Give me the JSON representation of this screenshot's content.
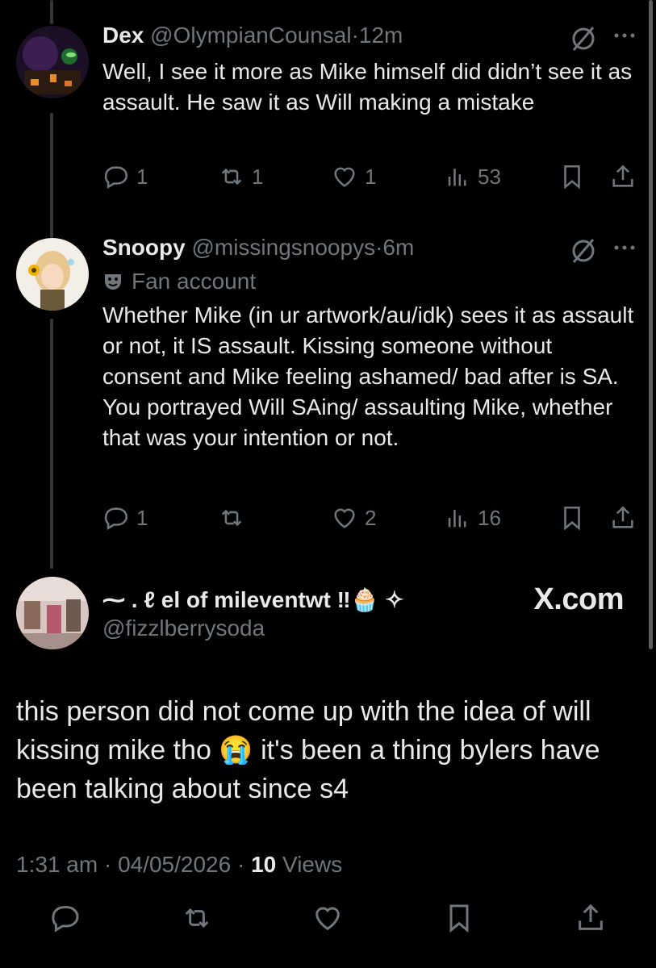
{
  "tweets": [
    {
      "name": "Dex",
      "handle": "@OlympianCounsal",
      "time": "12m",
      "text": "Well, I see it more as Mike himself did didn’t see it as assault. He saw it as Will making a mistake",
      "replies": "1",
      "reposts": "1",
      "likes": "1",
      "views": "53"
    },
    {
      "name": "Snoopy",
      "handle": "@missingsnoopys",
      "time": "6m",
      "badge": "Fan account",
      "text": "Whether Mike (in ur artwork/au/idk) sees it as assault or not, it IS assault. Kissing someone without consent and Mike feeling ashamed/ bad after is SA. You portrayed Will SAing/ assaulting Mike, whether that was your intention or not.",
      "replies": "1",
      "reposts": "",
      "likes": "2",
      "views": "16"
    }
  ],
  "quote": {
    "name": "⁓ . ℓ el of mileventwt ‼🧁 ✧",
    "handle": "@fizzlberrysoda",
    "brand": "X.com",
    "text": "this person did not come up with the idea of will kissing mike tho 😭 it's been a thing bylers have been talking about since s4",
    "time": "1:31 am",
    "date": "04/05/2026",
    "views_count": "10",
    "views_label": "Views"
  },
  "separator": "·",
  "colors": {
    "background": "#000000",
    "text": "#e7e9ea",
    "muted": "#71767b"
  }
}
